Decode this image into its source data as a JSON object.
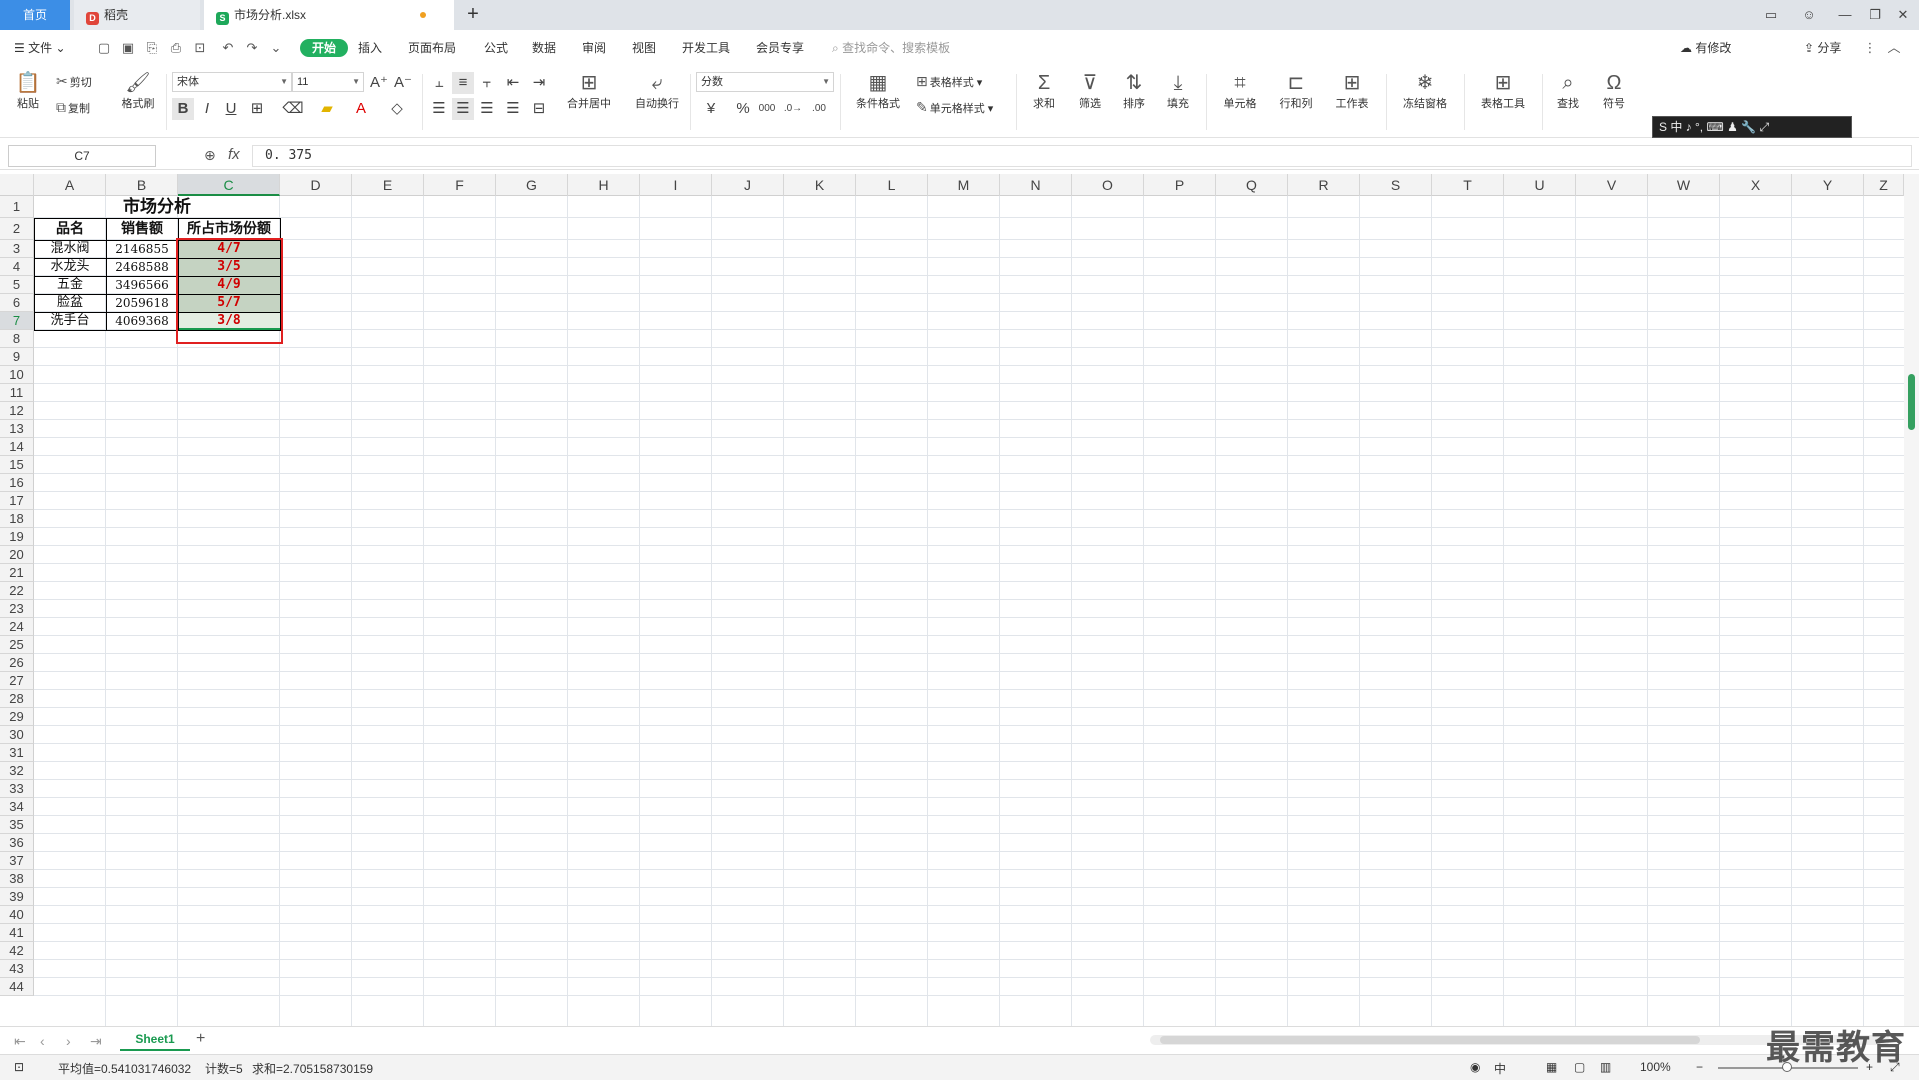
{
  "tabs": {
    "home": "首页",
    "doc": "稻壳",
    "file": "市场分析.xlsx"
  },
  "menu": {
    "file": "文件",
    "items": [
      "开始",
      "插入",
      "页面布局",
      "公式",
      "数据",
      "审阅",
      "视图",
      "开发工具",
      "会员专享"
    ],
    "search_placeholder": "查找命令、搜索模板",
    "share": "分享",
    "unsaved": "有修改"
  },
  "ribbon": {
    "paste": "粘贴",
    "cut": "剪切",
    "copy": "复制",
    "format_painter": "格式刷",
    "font": "宋体",
    "size": "11",
    "merge": "合并居中",
    "wrap": "自动换行",
    "number_format": "分数",
    "table_style": "表格样式",
    "cond_format": "条件格式",
    "cell_style": "单元格样式",
    "sum": "求和",
    "filter": "筛选",
    "sort": "排序",
    "fill": "填充",
    "cell": "单元格",
    "rowcol": "行和列",
    "worksheet": "工作表",
    "freeze": "冻结窗格",
    "table_tools": "表格工具",
    "find": "查找",
    "symbol": "符号"
  },
  "ime": "S 中 ♪ °, ⌨ ♟ 🔧 ⤢",
  "formula": {
    "name_box": "C7",
    "fx": "fx",
    "value": "0. 375"
  },
  "columns": [
    "A",
    "B",
    "C",
    "D",
    "E",
    "F",
    "G",
    "H",
    "I",
    "J",
    "K",
    "L",
    "M",
    "N",
    "O",
    "P",
    "Q",
    "R",
    "S",
    "T",
    "U",
    "V",
    "W",
    "X",
    "Y",
    "Z"
  ],
  "rows": [
    "1",
    "2",
    "3",
    "4",
    "5",
    "6",
    "7",
    "8",
    "9",
    "10",
    "11",
    "12",
    "13",
    "14",
    "15",
    "16",
    "17",
    "18",
    "19",
    "20",
    "21",
    "22",
    "23",
    "24",
    "25",
    "26",
    "27",
    "28",
    "29",
    "30",
    "31",
    "32",
    "33",
    "34",
    "35",
    "36",
    "37",
    "38",
    "39",
    "40",
    "41",
    "42",
    "43",
    "44"
  ],
  "table": {
    "title": "市场分析",
    "headers": [
      "品名",
      "销售额",
      "所占市场份额"
    ],
    "rows": [
      [
        "混水阀",
        "2146855",
        "4/7"
      ],
      [
        "水龙头",
        "2468588",
        "3/5"
      ],
      [
        "五金",
        "3496566",
        "4/9"
      ],
      [
        "脸盆",
        "2059618",
        "5/7"
      ],
      [
        "洗手台",
        "4069368",
        "3/8"
      ]
    ]
  },
  "sheet": {
    "name": "Sheet1"
  },
  "status": {
    "average": "平均值=0.541031746032",
    "count": "计数=5",
    "sum": "求和=2.705158730159",
    "zoom": "100%"
  },
  "watermark": "最需教育"
}
